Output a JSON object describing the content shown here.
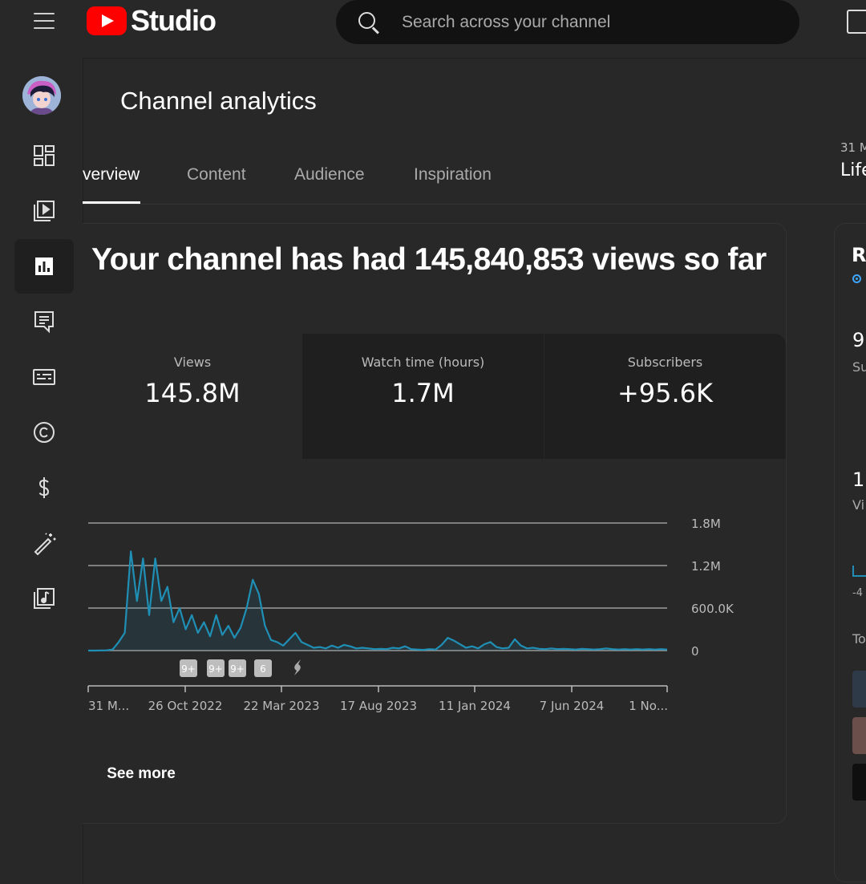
{
  "header": {
    "logo_text": "Studio",
    "search_placeholder": "Search across your channel"
  },
  "sidebar": {
    "items": [
      {
        "name": "dashboard",
        "icon": "dashboard-icon"
      },
      {
        "name": "content",
        "icon": "video-library-icon"
      },
      {
        "name": "analytics",
        "icon": "analytics-icon",
        "active": true
      },
      {
        "name": "comments",
        "icon": "comments-icon"
      },
      {
        "name": "subtitles",
        "icon": "subtitles-icon"
      },
      {
        "name": "copyright",
        "icon": "copyright-icon"
      },
      {
        "name": "earn",
        "icon": "dollar-icon"
      },
      {
        "name": "customization",
        "icon": "magic-wand-icon"
      },
      {
        "name": "audio-library",
        "icon": "audio-library-icon"
      }
    ]
  },
  "page": {
    "title": "Channel analytics",
    "right_date": "31 M",
    "right_lifetime": "Life"
  },
  "tabs": [
    {
      "label": "verview",
      "active": true
    },
    {
      "label": "Content"
    },
    {
      "label": "Audience"
    },
    {
      "label": "Inspiration"
    }
  ],
  "overview": {
    "headline": "Your channel has had 145,840,853 views so far",
    "metrics": [
      {
        "label": "Views",
        "value": "145.8M"
      },
      {
        "label": "Watch time (hours)",
        "value": "1.7M"
      },
      {
        "label": "Subscribers",
        "value": "+95.6K"
      }
    ],
    "see_more": "See more"
  },
  "chart_data": {
    "type": "line",
    "series": [
      {
        "values": [
          0,
          0,
          1000,
          3000,
          15000,
          120000,
          250000,
          1400000,
          700000,
          1300000,
          500000,
          1300000,
          700000,
          900000,
          400000,
          600000,
          300000,
          500000,
          250000,
          400000,
          200000,
          500000,
          220000,
          350000,
          180000,
          320000,
          600000,
          1000000,
          800000,
          350000,
          150000,
          120000,
          70000,
          160000,
          250000,
          120000,
          80000,
          40000,
          50000,
          30000,
          70000,
          40000,
          80000,
          60000,
          30000,
          40000,
          30000,
          20000,
          25000,
          20000,
          40000,
          30000,
          60000,
          20000,
          15000,
          10000,
          20000,
          15000,
          80000,
          180000,
          140000,
          90000,
          40000,
          60000,
          30000,
          90000,
          120000,
          50000,
          30000,
          40000,
          160000,
          70000,
          30000,
          40000,
          25000,
          20000,
          30000,
          20000,
          25000,
          20000,
          15000,
          25000,
          20000,
          15000,
          20000,
          30000,
          20000,
          15000,
          20000,
          15000,
          20000,
          15000,
          20000,
          15000,
          20000,
          15000
        ]
      }
    ],
    "y_ticks": [
      "1.8M",
      "1.2M",
      "600.0K",
      "0"
    ],
    "ylim": [
      0,
      1800000
    ],
    "x_ticks": [
      "31 M...",
      "26 Oct 2022",
      "22 Mar 2023",
      "17 Aug 2023",
      "11 Jan 2024",
      "7 Jun 2024",
      "1 No..."
    ],
    "grid": true,
    "markers": [
      {
        "label": "9+"
      },
      {
        "label": "9+"
      },
      {
        "label": "9+"
      },
      {
        "label": "6"
      },
      {
        "label": "",
        "icon": "shorts-icon"
      }
    ]
  },
  "right_panel": {
    "heading": "R",
    "stat1": "9",
    "stat1_label": "Su",
    "stat2": "1",
    "stat2_label": "Vi",
    "axis_value": "-4",
    "section": "To"
  },
  "colors": {
    "background": "#282828",
    "accent": "#1f8fb5",
    "logo_red": "#ff0000"
  }
}
